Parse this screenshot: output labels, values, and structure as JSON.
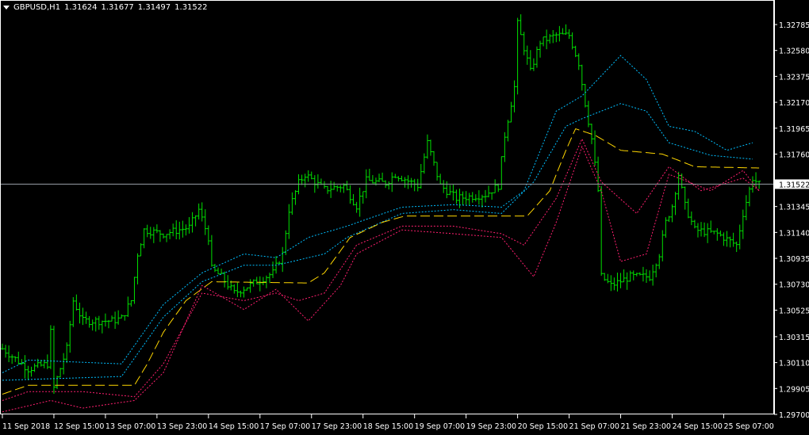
{
  "header": {
    "symbol": "GBPUSD,H1",
    "open": "1.31624",
    "high": "1.31677",
    "low": "1.31497",
    "close": "1.31522"
  },
  "colors": {
    "background": "#000000",
    "bars": "#00e000",
    "grid": "#ffffff",
    "middle": "#ffd700",
    "upper": "#00bfff",
    "lower": "#ff1f6f",
    "current_line": "#9aa0a8"
  },
  "chart_data": {
    "type": "line",
    "title": "GBPUSD,H1",
    "ylim": [
      1.297,
      1.32785
    ],
    "xlim": [
      0,
      240
    ],
    "bars_per_label": 16,
    "y_ticks": [
      "1.32785",
      "1.32580",
      "1.32375",
      "1.32170",
      "1.31965",
      "1.31760",
      "1.31345",
      "1.31140",
      "1.30935",
      "1.30730",
      "1.30525",
      "1.30315",
      "1.30110",
      "1.29905",
      "1.29700"
    ],
    "x_ticks": [
      "11 Sep 2018",
      "12 Sep 15:00",
      "13 Sep 07:00",
      "13 Sep 23:00",
      "14 Sep 15:00",
      "17 Sep 07:00",
      "17 Sep 23:00",
      "18 Sep 15:00",
      "19 Sep 07:00",
      "19 Sep 23:00",
      "20 Sep 15:00",
      "21 Sep 07:00",
      "21 Sep 23:00",
      "24 Sep 15:00",
      "25 Sep 07:00"
    ],
    "current_price": "1.31522",
    "price_path": [
      [
        0,
        1.3022
      ],
      [
        8,
        1.3006
      ],
      [
        14,
        1.301
      ],
      [
        15,
        1.3035
      ],
      [
        16,
        1.2991
      ],
      [
        20,
        1.3022
      ],
      [
        22,
        1.306
      ],
      [
        25,
        1.3044
      ],
      [
        34,
        1.3044
      ],
      [
        37,
        1.3046
      ],
      [
        40,
        1.306
      ],
      [
        42,
        1.3097
      ],
      [
        44,
        1.3116
      ],
      [
        50,
        1.3113
      ],
      [
        58,
        1.3118
      ],
      [
        61,
        1.3132
      ],
      [
        64,
        1.311
      ],
      [
        65,
        1.3085
      ],
      [
        68,
        1.3079
      ],
      [
        72,
        1.3066
      ],
      [
        79,
        1.3075
      ],
      [
        84,
        1.3082
      ],
      [
        87,
        1.3097
      ],
      [
        89,
        1.3132
      ],
      [
        92,
        1.3153
      ],
      [
        94,
        1.316
      ],
      [
        100,
        1.3148
      ],
      [
        106,
        1.3151
      ],
      [
        110,
        1.3135
      ],
      [
        113,
        1.3155
      ],
      [
        119,
        1.3153
      ],
      [
        122,
        1.316
      ],
      [
        129,
        1.3151
      ],
      [
        132,
        1.3185
      ],
      [
        136,
        1.3151
      ],
      [
        141,
        1.3141
      ],
      [
        150,
        1.3144
      ],
      [
        154,
        1.3151
      ],
      [
        156,
        1.3191
      ],
      [
        159,
        1.3229
      ],
      [
        160,
        1.3279
      ],
      [
        162,
        1.326
      ],
      [
        164,
        1.3241
      ],
      [
        167,
        1.3265
      ],
      [
        172,
        1.327
      ],
      [
        176,
        1.327
      ],
      [
        179,
        1.3248
      ],
      [
        181,
        1.3216
      ],
      [
        183,
        1.3188
      ],
      [
        185,
        1.3147
      ],
      [
        186,
        1.3079
      ],
      [
        189,
        1.3072
      ],
      [
        195,
        1.3079
      ],
      [
        201,
        1.3079
      ],
      [
        204,
        1.3097
      ],
      [
        206,
        1.3122
      ],
      [
        208,
        1.3135
      ],
      [
        210,
        1.316
      ],
      [
        212,
        1.3135
      ],
      [
        215,
        1.3116
      ],
      [
        222,
        1.3113
      ],
      [
        226,
        1.3107
      ],
      [
        228,
        1.3104
      ],
      [
        230,
        1.3129
      ],
      [
        233,
        1.3157
      ],
      [
        235,
        1.3152
      ]
    ],
    "series": [
      {
        "name": "upper_outer",
        "color": "#00bfff",
        "points": [
          [
            0,
            1.3003
          ],
          [
            8,
            1.3013
          ],
          [
            37,
            1.301
          ],
          [
            50,
            1.3057
          ],
          [
            62,
            1.3082
          ],
          [
            75,
            1.3097
          ],
          [
            85,
            1.3094
          ],
          [
            95,
            1.311
          ],
          [
            107,
            1.3119
          ],
          [
            124,
            1.3134
          ],
          [
            140,
            1.3136
          ],
          [
            155,
            1.3134
          ],
          [
            162,
            1.3147
          ],
          [
            172,
            1.321
          ],
          [
            180,
            1.3222
          ],
          [
            192,
            1.3254
          ],
          [
            200,
            1.3235
          ],
          [
            207,
            1.3198
          ],
          [
            215,
            1.3194
          ],
          [
            225,
            1.3179
          ],
          [
            233,
            1.3185
          ]
        ]
      },
      {
        "name": "upper_inner",
        "color": "#00bfff",
        "points": [
          [
            0,
            1.2997
          ],
          [
            37,
            1.3
          ],
          [
            50,
            1.3047
          ],
          [
            62,
            1.3075
          ],
          [
            75,
            1.3088
          ],
          [
            85,
            1.3088
          ],
          [
            100,
            1.3097
          ],
          [
            107,
            1.311
          ],
          [
            124,
            1.3129
          ],
          [
            140,
            1.3132
          ],
          [
            155,
            1.3129
          ],
          [
            165,
            1.3154
          ],
          [
            175,
            1.3198
          ],
          [
            180,
            1.3204
          ],
          [
            192,
            1.3216
          ],
          [
            200,
            1.321
          ],
          [
            207,
            1.3185
          ],
          [
            220,
            1.3175
          ],
          [
            233,
            1.3172
          ]
        ]
      },
      {
        "name": "middle",
        "color": "#ffd700",
        "points": [
          [
            0,
            1.2986
          ],
          [
            8,
            1.2993
          ],
          [
            41,
            1.2993
          ],
          [
            45,
            1.301
          ],
          [
            50,
            1.3035
          ],
          [
            57,
            1.306
          ],
          [
            65,
            1.3075
          ],
          [
            95,
            1.3074
          ],
          [
            100,
            1.3082
          ],
          [
            108,
            1.311
          ],
          [
            118,
            1.3122
          ],
          [
            125,
            1.3127
          ],
          [
            163,
            1.3127
          ],
          [
            170,
            1.3147
          ],
          [
            175,
            1.3179
          ],
          [
            178,
            1.3196
          ],
          [
            184,
            1.3191
          ],
          [
            192,
            1.3179
          ],
          [
            205,
            1.3176
          ],
          [
            215,
            1.3166
          ],
          [
            235,
            1.3165
          ]
        ]
      },
      {
        "name": "lower_inner",
        "color": "#ff1f6f",
        "points": [
          [
            0,
            1.2981
          ],
          [
            8,
            1.2988
          ],
          [
            25,
            1.2988
          ],
          [
            41,
            1.2984
          ],
          [
            50,
            1.301
          ],
          [
            62,
            1.3066
          ],
          [
            75,
            1.306
          ],
          [
            85,
            1.3066
          ],
          [
            92,
            1.306
          ],
          [
            100,
            1.3066
          ],
          [
            110,
            1.3104
          ],
          [
            124,
            1.3119
          ],
          [
            140,
            1.3119
          ],
          [
            155,
            1.3113
          ],
          [
            162,
            1.3104
          ],
          [
            172,
            1.3141
          ],
          [
            180,
            1.3188
          ],
          [
            186,
            1.3154
          ],
          [
            197,
            1.3129
          ],
          [
            207,
            1.3166
          ],
          [
            217,
            1.3147
          ],
          [
            230,
            1.3157
          ],
          [
            235,
            1.3147
          ]
        ]
      },
      {
        "name": "lower_outer",
        "color": "#ff1f6f",
        "points": [
          [
            0,
            1.2972
          ],
          [
            15,
            1.2981
          ],
          [
            25,
            1.2975
          ],
          [
            41,
            1.2981
          ],
          [
            50,
            1.3003
          ],
          [
            62,
            1.3072
          ],
          [
            75,
            1.3053
          ],
          [
            85,
            1.3069
          ],
          [
            95,
            1.3044
          ],
          [
            105,
            1.3072
          ],
          [
            110,
            1.3097
          ],
          [
            124,
            1.3116
          ],
          [
            140,
            1.3113
          ],
          [
            155,
            1.311
          ],
          [
            165,
            1.3079
          ],
          [
            172,
            1.3122
          ],
          [
            180,
            1.3182
          ],
          [
            186,
            1.3147
          ],
          [
            192,
            1.3091
          ],
          [
            200,
            1.3097
          ],
          [
            207,
            1.316
          ],
          [
            220,
            1.3147
          ],
          [
            230,
            1.3163
          ],
          [
            235,
            1.3147
          ]
        ]
      }
    ]
  }
}
